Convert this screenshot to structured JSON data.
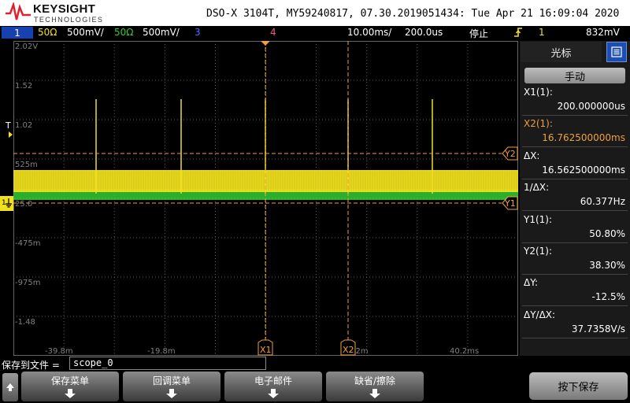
{
  "header": {
    "brand": "KEYSIGHT",
    "brand_sub": "TECHNOLOGIES",
    "title": "DSO-X 3104T, MY59240817, 07.30.2019051434: Tue Apr 21 16:09:04 2020"
  },
  "status_bar": {
    "ch1_number": "1",
    "ch1_impedance": "50Ω",
    "ch1_scale": "500mV/",
    "ch2_number": "2",
    "ch2_impedance": "50Ω",
    "ch2_scale": "500mV/",
    "ch3_number": "3",
    "ch4_number": "4",
    "timebase": "10.00ms/",
    "delay": "200.0us",
    "run_state": "停止",
    "trigger_icon": "trigger-edge-icon",
    "trigger_source": "1",
    "trigger_level": "832mV"
  },
  "plot": {
    "y_labels": [
      "2.02V",
      "1.52",
      "1.02",
      "525m",
      "25.0",
      "-475m",
      "-975m",
      "-1.48"
    ],
    "x_labels": [
      "-39.8m",
      "-19.8m",
      "0.2m",
      "40.2ms"
    ],
    "trigger_marker": "T",
    "ground_marker": "1",
    "cursor_x1": "X1",
    "cursor_x2": "X2",
    "cursor_y1": "Y1",
    "cursor_y2": "Y2"
  },
  "colors": {
    "ch1": "#f0e020",
    "ch2": "#33cc33",
    "ch3": "#4d6bff",
    "ch4": "#ff4d8a",
    "cursor": "#f0a040",
    "panel_blue": "#1d4fb3"
  },
  "cursor_panel": {
    "tab_label": "光标",
    "mode_button": "手动",
    "readouts": [
      {
        "label": "X1(1):",
        "value": "200.000000us",
        "color": "#ffffff"
      },
      {
        "label": "X2(1):",
        "value": "16.762500000ms",
        "color": "#f0a040"
      },
      {
        "label": "ΔX:",
        "value": "16.562500000ms",
        "color": "#ffffff"
      },
      {
        "label": "1/ΔX:",
        "value": "60.377Hz",
        "color": "#ffffff"
      },
      {
        "label": "Y1(1):",
        "value": "50.80%",
        "color": "#ffffff"
      },
      {
        "label": "Y2(1):",
        "value": "38.30%",
        "color": "#ffffff"
      },
      {
        "label": "ΔY:",
        "value": "-12.5%",
        "color": "#ffffff"
      },
      {
        "label": "ΔY/ΔX:",
        "value": "37.7358V/s",
        "color": "#ffffff"
      }
    ]
  },
  "save": {
    "label": "保存到文件 =",
    "filename": "scope_0"
  },
  "softkeys": {
    "save_menu": "保存菜单",
    "recall_menu": "回调菜单",
    "email": "电子邮件",
    "default_erase": "缺省/擦除",
    "press_to_save": "按下保存"
  }
}
